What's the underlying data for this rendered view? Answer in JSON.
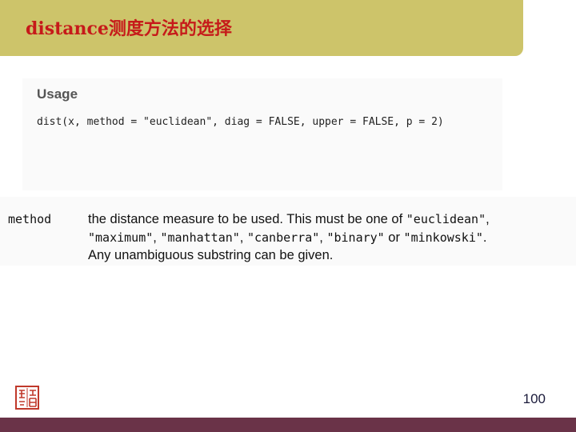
{
  "slide": {
    "title": "distance测度方法的选择",
    "page_number": "100"
  },
  "usage": {
    "heading": "Usage",
    "code": "dist(x, method = \"euclidean\", diag = FALSE, upper = FALSE, p = 2)"
  },
  "argument": {
    "name": "method",
    "line1_text": "the distance measure to be used. This must be one of ",
    "line1_code": "\"euclidean\"",
    "line1_end": ",",
    "line2_code1": "\"maximum\"",
    "sep1": ", ",
    "line2_code2": "\"manhattan\"",
    "sep2": ", ",
    "line2_code3": "\"canberra\"",
    "sep3": ", ",
    "line2_code4": "\"binary\"",
    "sep4": " or ",
    "line2_code5": "\"minkowski\"",
    "line2_end": ".",
    "line3_text": "Any unambiguous substring can be given."
  },
  "icons": {
    "seal": "red-seal-logo"
  },
  "colors": {
    "title_bar": "#cdc46a",
    "title_text": "#c61a1a",
    "footer_bar": "#6a3348",
    "seal": "#c0392b"
  }
}
